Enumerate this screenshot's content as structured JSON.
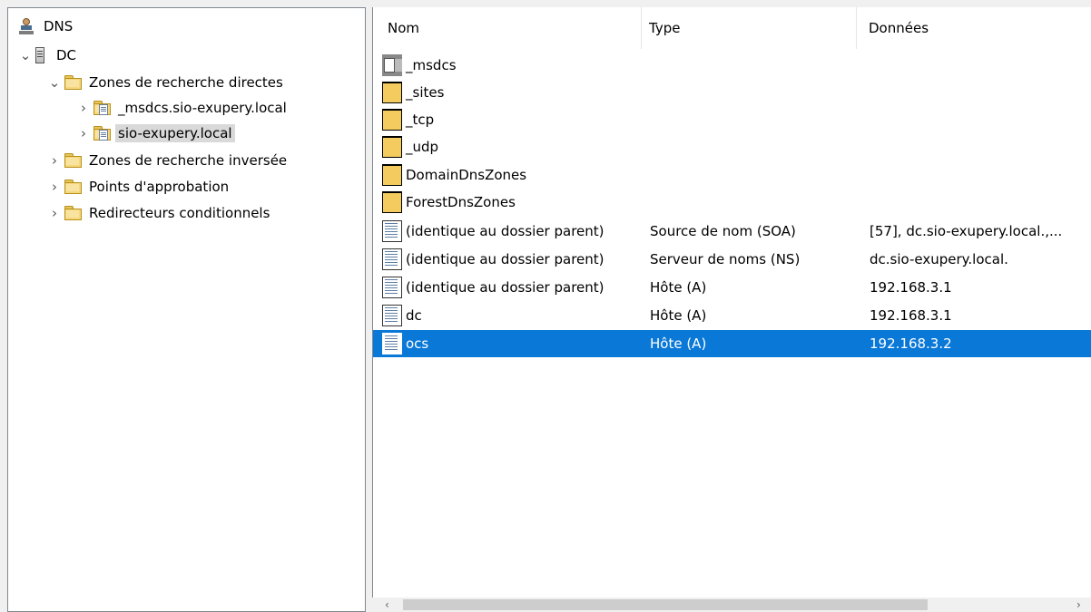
{
  "tree": {
    "root": "DNS",
    "server": "DC",
    "forward_zones": "Zones de recherche directes",
    "zone_msdcs": "_msdcs.sio-exupery.local",
    "zone_main": "sio-exupery.local",
    "reverse_zones": "Zones de recherche inversée",
    "trust_points": "Points d'approbation",
    "conditional_forwarders": "Redirecteurs conditionnels"
  },
  "list": {
    "columns": [
      "Nom",
      "Type",
      "Données"
    ],
    "rows": [
      {
        "name": "_msdcs",
        "type": "",
        "data": "",
        "icon": "zone-folder-icon"
      },
      {
        "name": "_sites",
        "type": "",
        "data": "",
        "icon": "folder-icon"
      },
      {
        "name": "_tcp",
        "type": "",
        "data": "",
        "icon": "folder-icon"
      },
      {
        "name": "_udp",
        "type": "",
        "data": "",
        "icon": "folder-icon"
      },
      {
        "name": "DomainDnsZones",
        "type": "",
        "data": "",
        "icon": "folder-icon"
      },
      {
        "name": "ForestDnsZones",
        "type": "",
        "data": "",
        "icon": "folder-icon"
      },
      {
        "name": "(identique au dossier parent)",
        "type": "Source de nom (SOA)",
        "data": "[57], dc.sio-exupery.local.,...",
        "icon": "record-icon"
      },
      {
        "name": "(identique au dossier parent)",
        "type": "Serveur de noms (NS)",
        "data": "dc.sio-exupery.local.",
        "icon": "record-icon"
      },
      {
        "name": "(identique au dossier parent)",
        "type": "Hôte (A)",
        "data": "192.168.3.1",
        "icon": "record-icon"
      },
      {
        "name": "dc",
        "type": "Hôte (A)",
        "data": "192.168.3.1",
        "icon": "record-icon"
      },
      {
        "name": "ocs",
        "type": "Hôte (A)",
        "data": "192.168.3.2",
        "icon": "record-icon",
        "selected": true
      }
    ]
  },
  "colors": {
    "selection": "#0a78d7",
    "tree_selection": "#d9d9d9"
  }
}
